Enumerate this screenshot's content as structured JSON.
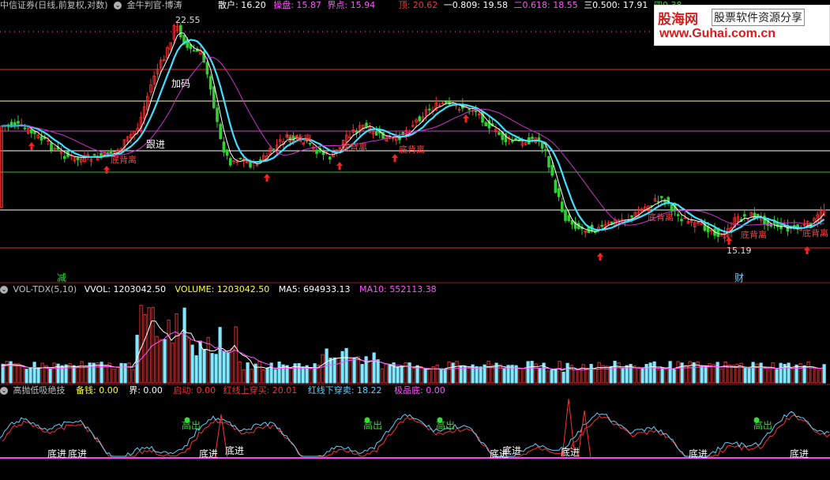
{
  "main_header": {
    "title": "中信证券(日线,前复权,对数)",
    "indicator": "金牛判官-博涛",
    "items": [
      {
        "label": "散户: 16.20",
        "color": "#ffffff"
      },
      {
        "label": "操盘: 15.87",
        "color": "#ff55ff"
      },
      {
        "label": "界点: 15.94",
        "color": "#ff55ff"
      },
      {
        "label": "顶: 20.62",
        "color": "#ff3030"
      },
      {
        "label": "一0.809: 19.58",
        "color": "#ffffff"
      },
      {
        "label": "二0.618: 18.55",
        "color": "#ff55ff"
      },
      {
        "label": "三0.500: 17.91",
        "color": "#ffffff"
      },
      {
        "label": "四0.38",
        "color": "#30d030"
      }
    ]
  },
  "logo": {
    "brand": "股海网",
    "slogan": "股票软件资源分享",
    "url": "www.Guhai.com.cn"
  },
  "main_annotations": {
    "high_price": "22.55",
    "low_price": "15.19",
    "jiama": "加码",
    "genjin": "跟进",
    "dibeili_1": "底背离",
    "dibeili_2": "底背离",
    "dibeili_3": "底背离",
    "dibeili_4": "底背离",
    "dibeili_5": "底背离",
    "dibeili_6": "底背离",
    "dibeili_7": "底背离",
    "jian": "减",
    "cai": "财"
  },
  "vol_header": {
    "name": "VOL-TDX(5,10)",
    "vvol": "VVOL: 1203042.50",
    "volume": "VOLUME: 1203042.50",
    "ma5": "MA5: 694933.13",
    "ma10": "MA10: 552113.38"
  },
  "ind_header": {
    "name": "高抛低吸绝技",
    "beiqian": "备钱: 0.00",
    "jie": "界: 0.00",
    "qidong": "启动: 0.00",
    "red_cross": "红线上穿买: 20.01",
    "blue_cross": "红线下穿卖: 18.22",
    "jipindi": "极品底: 0.00"
  },
  "ind_annotations": {
    "gaochu": "高出",
    "dijin": "底进"
  },
  "colors": {
    "background": "#000000",
    "up": "#ff3030",
    "down": "#30d030",
    "ma_fast": "#ffffff",
    "ma_mid": "#40e0ff",
    "ma_slow": "#cc33cc",
    "vol_up": "#e03030",
    "vol_down": "#80e8ff",
    "separator": "#a01818"
  }
}
